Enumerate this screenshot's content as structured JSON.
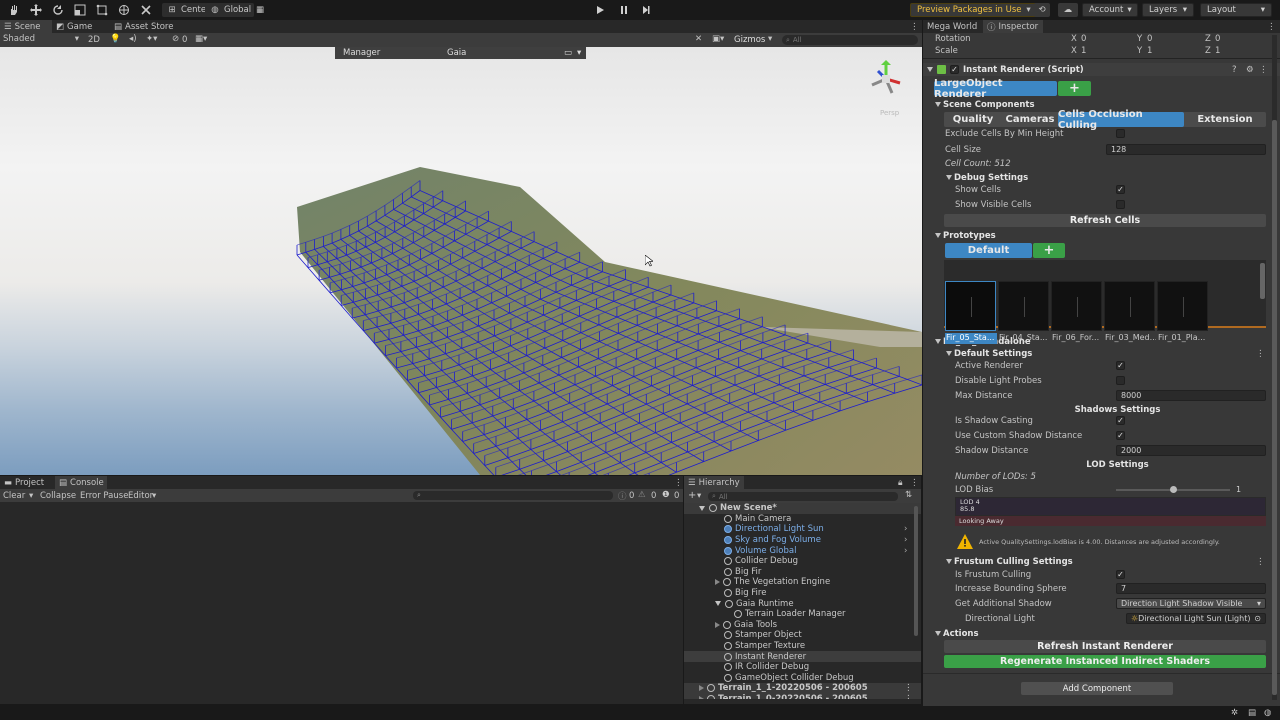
{
  "toolbar": {
    "tools": [
      "hand-tool",
      "move-tool",
      "rotate-tool",
      "scale-tool",
      "rect-tool",
      "transform-tool",
      "custom-tool"
    ],
    "pivot_label": "Center",
    "space_label": "Global",
    "preview_packages": "Preview Packages in Use",
    "account": "Account",
    "layers": "Layers",
    "layout": "Layout"
  },
  "scene_tabs": {
    "scene": "Scene",
    "game": "Game",
    "asset_store": "Asset Store"
  },
  "scene_toolbar": {
    "shading": "Shaded",
    "mode_2d": "2D",
    "hidden_count": "0",
    "gizmos": "Gizmos",
    "search_placeholder": "All"
  },
  "overlay": {
    "left": "Manager",
    "center": "Gaia"
  },
  "viewport": {
    "persp_label": "Persp"
  },
  "project": {
    "tabs": {
      "project": "Project",
      "console": "Console"
    },
    "clear": "Clear",
    "collapse": "Collapse",
    "error_pause": "Error Pause",
    "editor": "Editor",
    "counts": {
      "info": "0",
      "warn": "0",
      "error": "0"
    }
  },
  "hierarchy": {
    "title": "Hierarchy",
    "search_placeholder": "All",
    "items": [
      {
        "label": "New Scene*",
        "indent": 0,
        "kind": "scene",
        "expanded": true
      },
      {
        "label": "Main Camera",
        "indent": 1
      },
      {
        "label": "Directional Light Sun",
        "indent": 1,
        "blue": true,
        "arrow": true
      },
      {
        "label": "Sky and Fog Volume",
        "indent": 1,
        "blue": true,
        "arrow": true
      },
      {
        "label": "Volume Global",
        "indent": 1,
        "blue": true,
        "arrow": true
      },
      {
        "label": "Collider Debug",
        "indent": 1
      },
      {
        "label": "Big Fir",
        "indent": 1
      },
      {
        "label": "The Vegetation Engine",
        "indent": 1,
        "collapsed": true
      },
      {
        "label": "Big Fire",
        "indent": 1
      },
      {
        "label": "Gaia Runtime",
        "indent": 1,
        "expanded": true
      },
      {
        "label": "Terrain Loader Manager",
        "indent": 2
      },
      {
        "label": "Gaia Tools",
        "indent": 1,
        "collapsed": true
      },
      {
        "label": "Stamper Object",
        "indent": 1
      },
      {
        "label": "Stamper Texture",
        "indent": 1
      },
      {
        "label": "Instant Renderer",
        "indent": 1,
        "selected": true
      },
      {
        "label": "IR Collider Debug",
        "indent": 1
      },
      {
        "label": "GameObject Collider Debug",
        "indent": 1
      },
      {
        "label": "Terrain_1_1-20220506 - 200605",
        "indent": 0,
        "kind": "scene",
        "collapsed": true
      },
      {
        "label": "Terrain_1_0-20220506 - 200605",
        "indent": 0,
        "kind": "scene",
        "collapsed": true
      }
    ]
  },
  "inspector": {
    "tabs": {
      "mega_world": "Mega World",
      "inspector": "Inspector"
    },
    "rotation": {
      "label": "Rotation",
      "x": "0",
      "y": "0",
      "z": "0"
    },
    "scale": {
      "label": "Scale",
      "x": "1",
      "y": "1",
      "z": "1"
    },
    "component": "Instant Renderer (Script)",
    "largeobject": "LargeObject Renderer",
    "scene_components": "Scene Components",
    "comp_tabs": [
      "Quality",
      "Cameras",
      "Cells Occlusion Culling",
      "Extension"
    ],
    "active_tab": 2,
    "exclude_cells": "Exclude Cells By Min Height",
    "cell_size": {
      "label": "Cell Size",
      "value": "128"
    },
    "cell_count": "Cell Count: 512",
    "debug_settings": "Debug Settings",
    "show_cells": "Show Cells",
    "show_visible_cells": "Show Visible Cells",
    "refresh_cells": "Refresh Cells",
    "prototypes": "Prototypes",
    "default_btn": "Default",
    "thumbs": [
      "Fir_05_Sta...",
      "Fir_04_Sta...",
      "Fir_06_For...",
      "Fir_03_Med...",
      "Fir_01_Pla..."
    ],
    "fir_title": "Fir_05_Standalone",
    "default_settings": "Default Settings",
    "active_renderer": "Active Renderer",
    "disable_light_probes": "Disable Light Probes",
    "max_distance": {
      "label": "Max Distance",
      "value": "8000"
    },
    "shadows_settings": "Shadows Settings",
    "is_shadow_casting": "Is Shadow Casting",
    "use_custom_shadow": "Use Custom Shadow Distance",
    "shadow_distance": {
      "label": "Shadow Distance",
      "value": "2000"
    },
    "lod_settings": "LOD Settings",
    "number_of_lods": "Number of LODs: 5",
    "lod_bias": {
      "label": "LOD Bias",
      "value": "1",
      "slider": 0.5
    },
    "lod_bar": {
      "name": "LOD 4",
      "percent": "85.8",
      "note": "Looking Away"
    },
    "warning": "Active QualitySettings.lodBias is 4.00. Distances are adjusted accordingly.",
    "frustum": "Frustum Culling Settings",
    "is_frustum": "Is Frustum Culling",
    "increase_sphere": {
      "label": "Increase Bounding Sphere",
      "value": "7"
    },
    "get_shadow": {
      "label": "Get Additional Shadow",
      "value": "Direction Light Shadow Visible"
    },
    "dir_light": {
      "label": "Directional Light",
      "value": "Directional Light Sun (Light)"
    },
    "actions": "Actions",
    "refresh_instant": "Refresh Instant Renderer",
    "regenerate": "Regenerate Instanced Indirect Shaders",
    "add_component": "Add Component"
  },
  "colors": {
    "accent": "#3d87c4",
    "green": "#3aa047",
    "bg": "#383838",
    "wire": "#2020d0",
    "warning": "#f0b400"
  }
}
